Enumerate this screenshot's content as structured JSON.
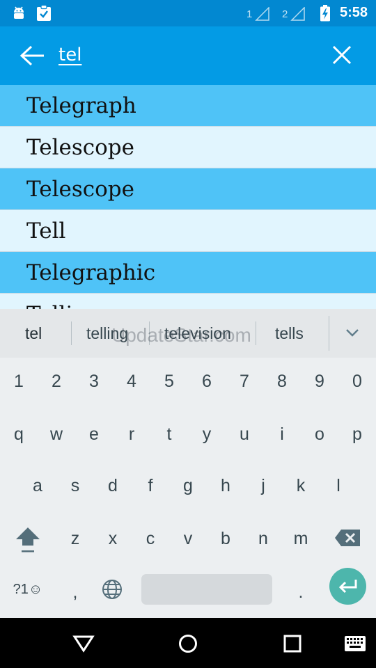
{
  "status_bar": {
    "time": "5:58",
    "sim1": "1",
    "sim2": "2",
    "icons": [
      "android-icon",
      "clipboard-check-icon",
      "signal-icon",
      "battery-charging-icon"
    ]
  },
  "search": {
    "query": "tel"
  },
  "results": [
    {
      "word": "Telegraph"
    },
    {
      "word": "Telescope"
    },
    {
      "word": "Telescope"
    },
    {
      "word": "Tell"
    },
    {
      "word": "Telegraphic"
    },
    {
      "word": "Telling"
    }
  ],
  "keyboard": {
    "suggestions": [
      "tel",
      "telling",
      "television",
      "tells"
    ],
    "watermark": "UpdateStar.com",
    "row_numbers": [
      "1",
      "2",
      "3",
      "4",
      "5",
      "6",
      "7",
      "8",
      "9",
      "0"
    ],
    "row_1": [
      "q",
      "w",
      "e",
      "r",
      "t",
      "y",
      "u",
      "i",
      "o",
      "p"
    ],
    "row_2": [
      "a",
      "s",
      "d",
      "f",
      "g",
      "h",
      "j",
      "k",
      "l"
    ],
    "row_3": [
      "z",
      "x",
      "c",
      "v",
      "b",
      "n",
      "m"
    ],
    "symbols_label": "?1☺",
    "comma": ",",
    "period": "."
  },
  "colors": {
    "status_bar": "#0288d1",
    "app_bar": "#039be5",
    "row_highlight": "#4fc3f7",
    "row_light": "#e1f5fe",
    "enter_key": "#4db6ac"
  }
}
